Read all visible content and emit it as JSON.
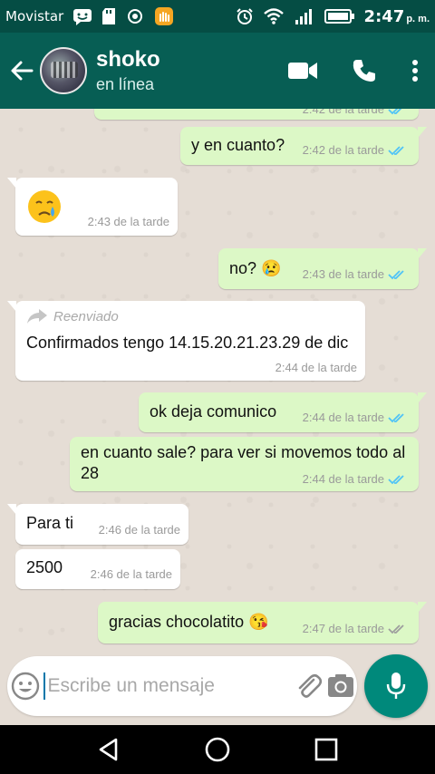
{
  "status_bar": {
    "carrier": "Movistar",
    "time": "2:47",
    "ampm": "p. m."
  },
  "header": {
    "contact_name": "shoko",
    "contact_status": "en línea"
  },
  "messages": [
    {
      "direction": "out",
      "text": "",
      "time": "2:42 de la tarde",
      "ticks": "read"
    },
    {
      "direction": "out",
      "text": "y en cuanto?",
      "time": "2:42 de la tarde",
      "ticks": "read"
    },
    {
      "direction": "in",
      "text": "😢",
      "time": "2:43 de la tarde"
    },
    {
      "direction": "out",
      "text": "no? 😢",
      "time": "2:43 de la tarde",
      "ticks": "read"
    },
    {
      "direction": "in",
      "forwarded_label": "Reenviado",
      "text": "Confirmados tengo 14.15.20.21.23.29 de dic",
      "time": "2:44 de la tarde"
    },
    {
      "direction": "out",
      "text": "ok deja comunico",
      "time": "2:44 de la tarde",
      "ticks": "read"
    },
    {
      "direction": "out",
      "text": "en cuanto sale? para ver si movemos todo al 28",
      "time": "2:44 de la tarde",
      "ticks": "read"
    },
    {
      "direction": "in",
      "text": "Para ti",
      "time": "2:46 de la tarde"
    },
    {
      "direction": "in",
      "text": "2500",
      "time": "2:46 de la tarde"
    },
    {
      "direction": "out",
      "text": "gracias chocolatito 😘",
      "time": "2:47 de la tarde",
      "ticks": "delivered"
    }
  ],
  "composer": {
    "placeholder": "Escribe un mensaje"
  },
  "colors": {
    "status_bar": "#054d44",
    "app_bar": "#075e54",
    "outgoing_bubble": "#dcf8c6",
    "incoming_bubble": "#ffffff",
    "read_ticks": "#4fc3f7",
    "delivered_ticks": "#9e9e9e",
    "mic_button": "#00897b"
  },
  "icons": {
    "back": "arrow-left-icon",
    "video": "video-camera-icon",
    "call": "phone-icon",
    "menu": "more-vert-icon",
    "emoji": "smiley-icon",
    "attach": "paperclip-icon",
    "camera": "camera-icon",
    "mic": "microphone-icon",
    "forward": "forward-arrow-icon"
  }
}
